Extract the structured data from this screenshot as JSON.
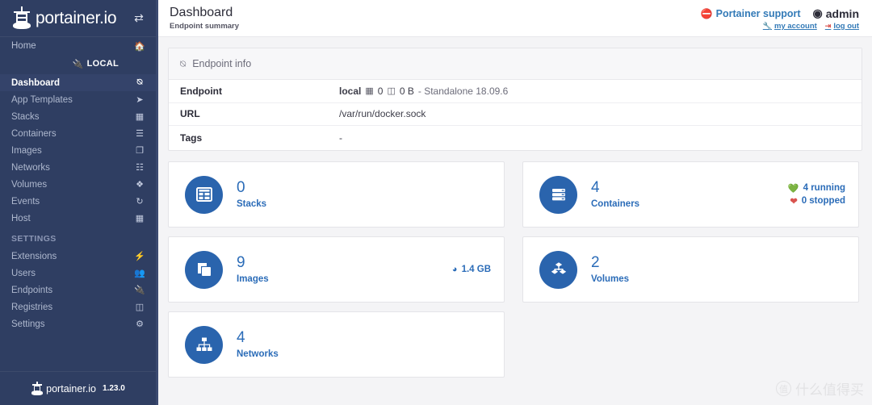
{
  "sidebar": {
    "brand": {
      "text": "portainer.io",
      "logo_icon": "lighthouse-logo",
      "toggle_icon": "sidebar-toggle-icon"
    },
    "home": {
      "label": "Home",
      "icon": "home-icon"
    },
    "local_badge": {
      "label": "LOCAL",
      "icon": "plug-icon"
    },
    "items": [
      {
        "label": "Dashboard",
        "icon": "dashboard-icon",
        "active": true
      },
      {
        "label": "App Templates",
        "icon": "rocket-icon",
        "active": false
      },
      {
        "label": "Stacks",
        "icon": "table-icon",
        "active": false
      },
      {
        "label": "Containers",
        "icon": "list-icon",
        "active": false
      },
      {
        "label": "Images",
        "icon": "clone-icon",
        "active": false
      },
      {
        "label": "Networks",
        "icon": "sitemap-icon",
        "active": false
      },
      {
        "label": "Volumes",
        "icon": "cubes-icon",
        "active": false
      },
      {
        "label": "Events",
        "icon": "history-icon",
        "active": false
      },
      {
        "label": "Host",
        "icon": "th-icon",
        "active": false
      }
    ],
    "settings_section": "SETTINGS",
    "settings_items": [
      {
        "label": "Extensions",
        "icon": "bolt-icon"
      },
      {
        "label": "Users",
        "icon": "users-icon"
      },
      {
        "label": "Endpoints",
        "icon": "plug-icon"
      },
      {
        "label": "Registries",
        "icon": "database-icon"
      },
      {
        "label": "Settings",
        "icon": "cogs-icon"
      }
    ],
    "footer": {
      "text": "portainer.io",
      "version": "1.23.0",
      "logo_icon": "lighthouse-logo"
    }
  },
  "header": {
    "title": "Dashboard",
    "subtitle": "Endpoint summary",
    "support_label": "Portainer support",
    "support_icon": "lifebuoy-icon",
    "user_name": "admin",
    "user_icon": "user-circle-icon",
    "my_account_label": "my account",
    "my_account_icon": "wrench-icon",
    "logout_label": "log out",
    "logout_icon": "signout-icon"
  },
  "endpoint_info": {
    "panel_title": "Endpoint info",
    "panel_icon": "dashboard-icon",
    "rows": [
      {
        "key": "Endpoint",
        "name": "local",
        "cpu_icon": "cpu-icon",
        "cpu": "0",
        "mem_icon": "memory-icon",
        "mem": "0 B",
        "details": "- Standalone 18.09.6"
      },
      {
        "key": "URL",
        "value": "/var/run/docker.sock"
      },
      {
        "key": "Tags",
        "value": "-"
      }
    ]
  },
  "cards": [
    {
      "icon": "stacks-icon",
      "count": "0",
      "label": "Stacks"
    },
    {
      "icon": "containers-icon",
      "count": "4",
      "label": "Containers",
      "aside": [
        {
          "icon": "heartbeat-green-icon",
          "text": "4 running",
          "color": "#23a24d"
        },
        {
          "icon": "heartbeat-red-icon",
          "text": "0 stopped",
          "color": "#d9534f"
        }
      ]
    },
    {
      "icon": "images-icon",
      "count": "9",
      "label": "Images",
      "aside": [
        {
          "icon": "pie-chart-icon",
          "text": "1.4 GB",
          "color": "#2b6cb8"
        }
      ]
    },
    {
      "icon": "volumes-icon",
      "count": "2",
      "label": "Volumes"
    },
    {
      "icon": "networks-icon",
      "count": "4",
      "label": "Networks"
    }
  ],
  "watermark": {
    "badge": "值",
    "text": "什么值得买"
  },
  "colors": {
    "sidebar_bg": "#2f3e62",
    "sidebar_active": "#34436a",
    "accent_blue": "#2b6cb8",
    "circle_blue": "#2a64ad",
    "link_blue": "#337ab7",
    "red": "#d9534f",
    "green": "#23a24d"
  }
}
